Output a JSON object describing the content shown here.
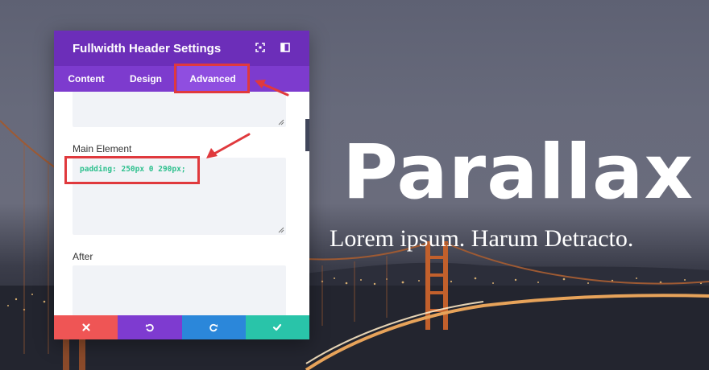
{
  "hero": {
    "title": "Parallax",
    "subtitle": "Lorem ipsum. Harum Detracto."
  },
  "panel": {
    "title": "Fullwidth Header Settings",
    "header_icons": [
      "fullscreen-icon",
      "split-view-icon"
    ],
    "tabs": [
      {
        "label": "Content",
        "active": false
      },
      {
        "label": "Design",
        "active": false
      },
      {
        "label": "Advanced",
        "active": true
      }
    ],
    "fields": {
      "main_element": {
        "label": "Main Element",
        "value": "padding: 250px 0 290px;"
      },
      "after": {
        "label": "After",
        "value": ""
      }
    },
    "footer_buttons": [
      {
        "name": "close",
        "icon": "close-icon",
        "color": "#ef5555"
      },
      {
        "name": "undo",
        "icon": "undo-icon",
        "color": "#7e3bd0"
      },
      {
        "name": "redo",
        "icon": "redo-icon",
        "color": "#2b87da"
      },
      {
        "name": "save",
        "icon": "check-icon",
        "color": "#29c4a9"
      }
    ]
  },
  "colors": {
    "panel_header": "#6c2eb9",
    "tabs_bar": "#7d3bce",
    "code_text": "#2ec08e",
    "annotation": "#e0393d"
  }
}
